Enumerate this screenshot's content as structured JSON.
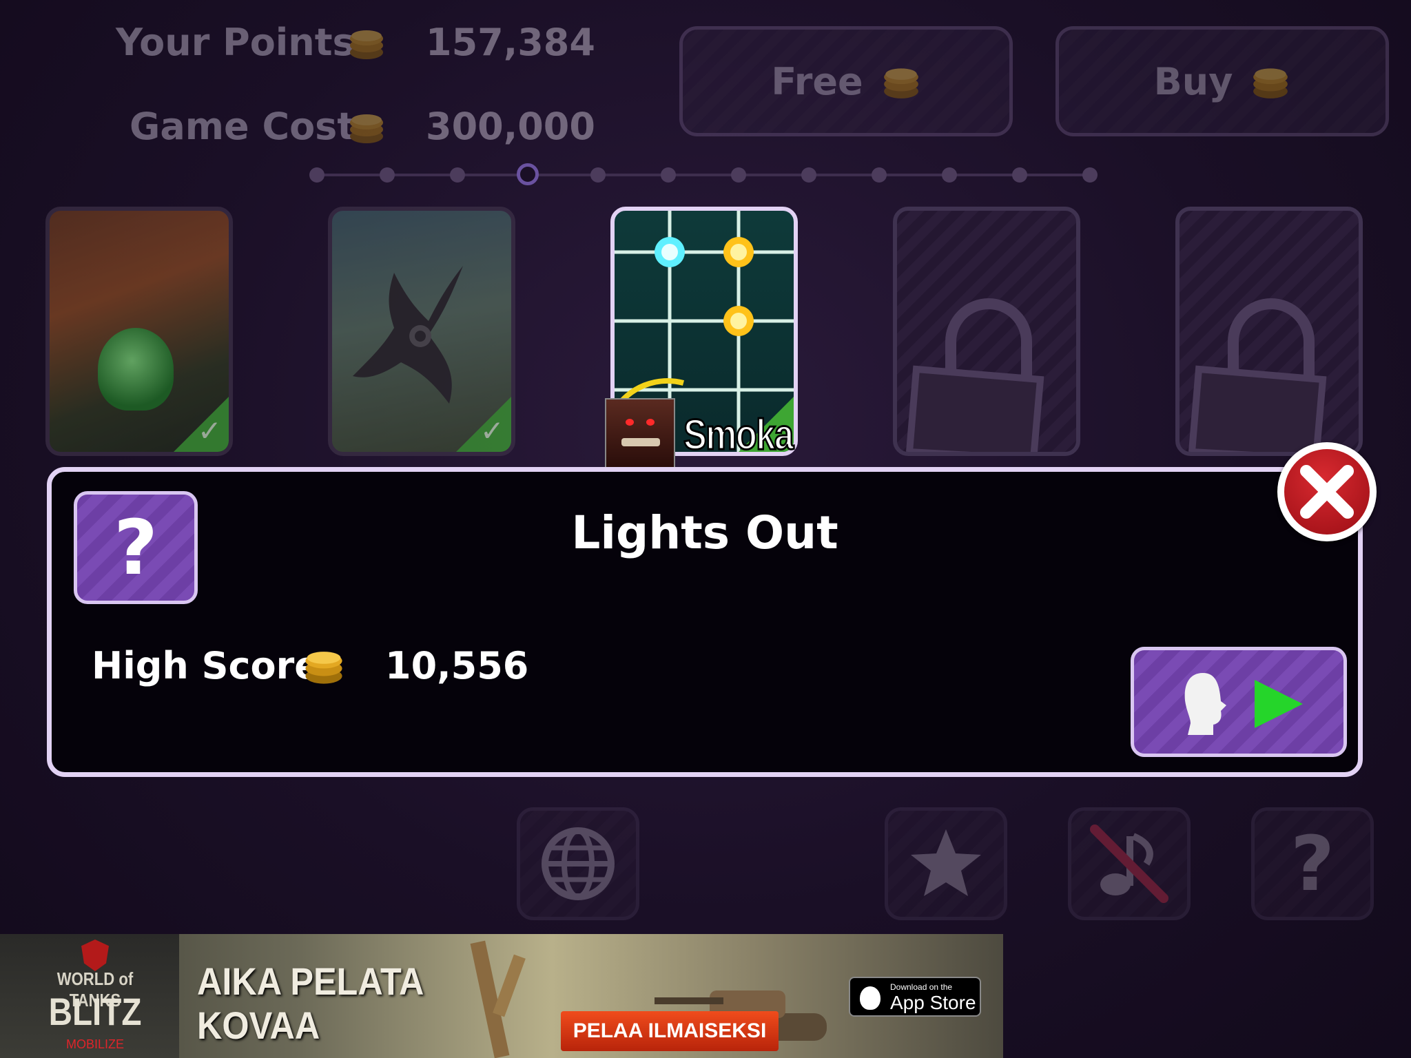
{
  "stats": {
    "points_label": "Your Points",
    "points_value": "157,384",
    "cost_label": "Game Cost",
    "cost_value": "300,000"
  },
  "top_buttons": {
    "free_label": "Free",
    "buy_label": "Buy"
  },
  "pager": {
    "total_pages": 12,
    "current_page": 4
  },
  "games": [
    {
      "name": "game-card-1",
      "state": "completed"
    },
    {
      "name": "game-card-2",
      "state": "completed"
    },
    {
      "name": "game-card-lights-out",
      "state": "selected"
    },
    {
      "name": "game-card-4",
      "state": "locked"
    },
    {
      "name": "game-card-5",
      "state": "locked"
    }
  ],
  "user": {
    "name": "Smoka"
  },
  "detail": {
    "title": "Lights Out",
    "high_score_label": "High Score",
    "high_score_value": "10,556",
    "help_glyph": "?",
    "play_icon": "single-player-play-icon"
  },
  "bottom_bar": {
    "icons": [
      "globe-icon",
      "star-icon",
      "music-muted-icon",
      "help-icon"
    ],
    "help_glyph": "?"
  },
  "ad": {
    "brand_line1": "WORLD of TANKS",
    "brand_line2": "BLITZ",
    "brand_line3": "MOBILIZE",
    "headline_line1": "AIKA PELATA",
    "headline_line2": "KOVAA",
    "cta": "PELAA ILMAISEKSI",
    "store_small": "Download on the",
    "store_big": "App Store"
  },
  "colors": {
    "panel_border": "#e2d2f4",
    "button_purple": "#7a4bb4",
    "close_red": "#b3121b",
    "play_green": "#25d52a"
  }
}
